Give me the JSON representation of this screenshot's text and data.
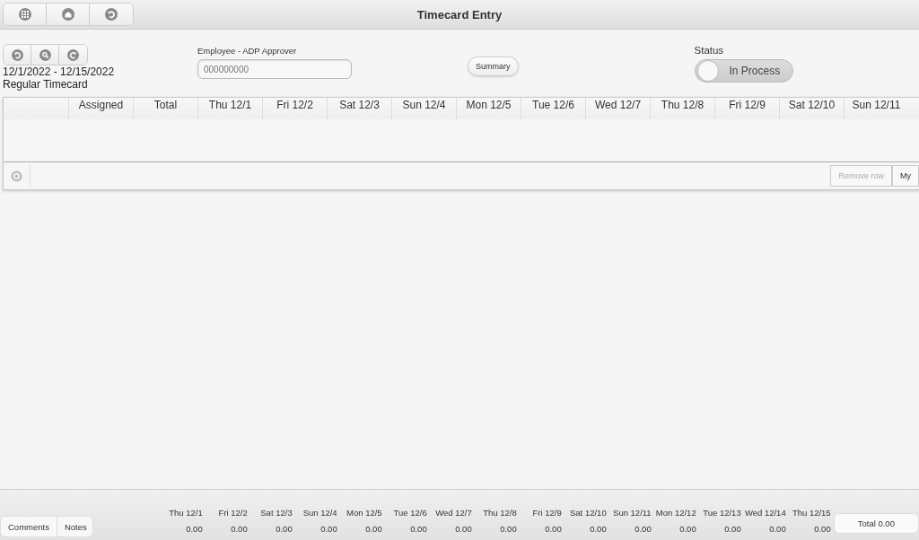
{
  "window": {
    "title": "Timecard Entry"
  },
  "date_range": "12/1/2022 - 12/15/2022",
  "timecard_type": "Regular Timecard",
  "employee_field": {
    "label": "Employee - ADP Approver",
    "placeholder": "000000000"
  },
  "summary_button": "Summary",
  "status": {
    "label": "Status",
    "value": "In Process",
    "on": false
  },
  "table": {
    "columns": [
      "Assigned",
      "Total",
      "Thu 12/1",
      "Fri 12/2",
      "Sat 12/3",
      "Sun 12/4",
      "Mon 12/5",
      "Tue 12/6",
      "Wed 12/7",
      "Thu 12/8",
      "Fri 12/9",
      "Sat 12/10",
      "Sun 12/11"
    ]
  },
  "table_buttons": [
    {
      "label": "Remove row",
      "disabled": true
    },
    {
      "label": "My",
      "disabled": false
    }
  ],
  "footer": {
    "tabs": [
      "Comments",
      "Notes"
    ],
    "days": [
      {
        "day": "Thu 12/1",
        "hours": "0.00"
      },
      {
        "day": "Fri 12/2",
        "hours": "0.00"
      },
      {
        "day": "Sat 12/3",
        "hours": "0.00"
      },
      {
        "day": "Sun 12/4",
        "hours": "0.00"
      },
      {
        "day": "Mon 12/5",
        "hours": "0.00"
      },
      {
        "day": "Tue 12/6",
        "hours": "0.00"
      },
      {
        "day": "Wed 12/7",
        "hours": "0.00"
      },
      {
        "day": "Thu 12/8",
        "hours": "0.00"
      },
      {
        "day": "Fri 12/9",
        "hours": "0.00"
      },
      {
        "day": "Sat 12/10",
        "hours": "0.00"
      },
      {
        "day": "Sun 12/11",
        "hours": "0.00"
      },
      {
        "day": "Mon 12/12",
        "hours": "0.00"
      },
      {
        "day": "Tue 12/13",
        "hours": "0.00"
      },
      {
        "day": "Wed 12/14",
        "hours": "0.00"
      },
      {
        "day": "Thu 12/15",
        "hours": "0.00"
      }
    ],
    "total": "Total 0.00"
  }
}
